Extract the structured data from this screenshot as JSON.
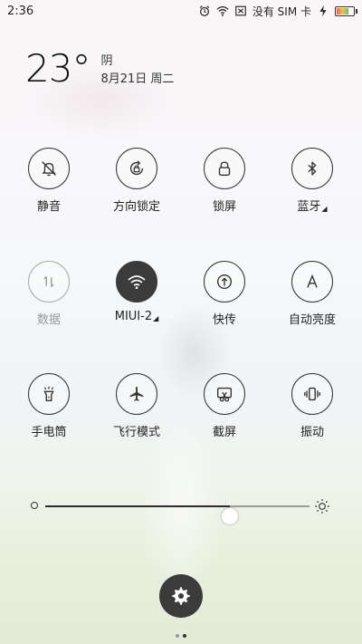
{
  "status_bar": {
    "time": "2:36",
    "carrier": "没有 SIM 卡",
    "battery_level": 0.75
  },
  "weather": {
    "temperature": "23°",
    "condition": "阴",
    "date": "8月21日 周二"
  },
  "toggles": [
    {
      "label": "静音",
      "icon": "bell-off-icon",
      "state": "off"
    },
    {
      "label": "方向锁定",
      "icon": "rotation-lock-icon",
      "state": "off"
    },
    {
      "label": "锁屏",
      "icon": "lock-icon",
      "state": "off"
    },
    {
      "label": "蓝牙",
      "icon": "bluetooth-icon",
      "state": "off",
      "has_menu": true
    },
    {
      "label": "数据",
      "icon": "data-arrows-icon",
      "state": "disabled"
    },
    {
      "label": "MIUI-2",
      "icon": "wifi-icon",
      "state": "on",
      "has_menu": true
    },
    {
      "label": "快传",
      "icon": "quick-transfer-icon",
      "state": "off"
    },
    {
      "label": "自动亮度",
      "icon": "auto-brightness-icon",
      "state": "off"
    },
    {
      "label": "手电筒",
      "icon": "flashlight-icon",
      "state": "off"
    },
    {
      "label": "飞行模式",
      "icon": "airplane-icon",
      "state": "off"
    },
    {
      "label": "截屏",
      "icon": "screenshot-icon",
      "state": "off"
    },
    {
      "label": "振动",
      "icon": "vibrate-icon",
      "state": "off"
    }
  ],
  "brightness": {
    "level": 0.7
  },
  "pager": {
    "pages": 2,
    "current": 2
  },
  "colors": {
    "active": "#3b3b3b",
    "icon": "#333333",
    "disabled": "#aaaaaa"
  }
}
